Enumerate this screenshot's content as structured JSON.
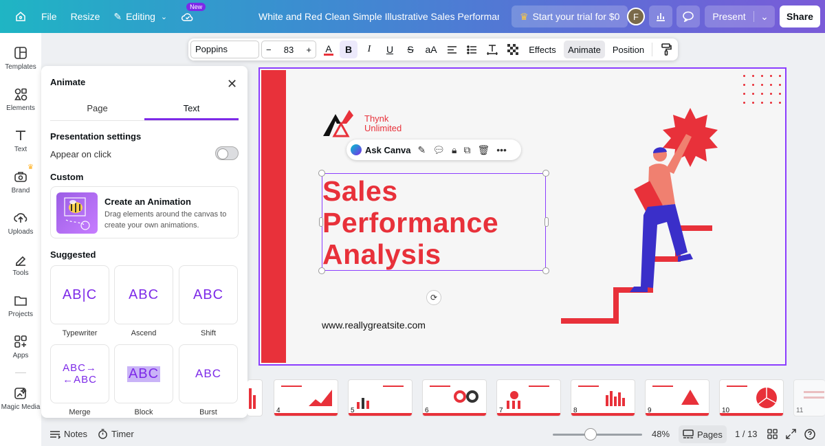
{
  "topbar": {
    "file": "File",
    "resize": "Resize",
    "editing": "Editing",
    "new_badge": "New",
    "doc_title": "White and Red Clean Simple Illustrative Sales Performance ...",
    "trial": "Start your trial for $0",
    "avatar_initial": "F",
    "present": "Present",
    "share": "Share"
  },
  "rail": [
    {
      "label": "Templates",
      "icon": "templates-icon"
    },
    {
      "label": "Elements",
      "icon": "elements-icon"
    },
    {
      "label": "Text",
      "icon": "text-icon"
    },
    {
      "label": "Brand",
      "icon": "brand-icon"
    },
    {
      "label": "Uploads",
      "icon": "uploads-icon"
    },
    {
      "label": "Tools",
      "icon": "tools-icon"
    },
    {
      "label": "Projects",
      "icon": "projects-icon"
    },
    {
      "label": "Apps",
      "icon": "apps-icon"
    },
    {
      "label": "Magic Media",
      "icon": "magic-media-icon"
    }
  ],
  "panel": {
    "title": "Animate",
    "tabs": [
      "Page",
      "Text"
    ],
    "active_tab": "Text",
    "presentation_settings": "Presentation settings",
    "appear_on_click": "Appear on click",
    "custom": "Custom",
    "create_title": "Create an Animation",
    "create_desc": "Drag elements around the canvas to create your own animations.",
    "suggested": "Suggested",
    "animations": [
      {
        "label": "Typewriter",
        "preview": "AB|C"
      },
      {
        "label": "Ascend",
        "preview": "ABC"
      },
      {
        "label": "Shift",
        "preview": "ABC"
      },
      {
        "label": "Merge",
        "preview": "ABC→ ←ABC"
      },
      {
        "label": "Block",
        "preview": "ABC"
      },
      {
        "label": "Burst",
        "preview": "ABC"
      }
    ]
  },
  "toolbar": {
    "font": "Poppins",
    "size_minus": "−",
    "size": "83",
    "size_plus": "+",
    "text_color_glyph": "A",
    "bold": "B",
    "italic": "I",
    "underline": "U",
    "strike": "S",
    "case": "aA",
    "effects": "Effects",
    "animate": "Animate",
    "position": "Position"
  },
  "slide": {
    "logo_line1": "Thynk",
    "logo_line2": "Unlimited",
    "headline_1": "Sales",
    "headline_2": "Performance",
    "headline_3": "Analysis",
    "website": "www.reallygreatsite.com",
    "accent": "#e8313a"
  },
  "ask": {
    "label": "Ask Canva"
  },
  "filmstrip": [
    "4",
    "5",
    "6",
    "7",
    "8",
    "9",
    "10",
    "11"
  ],
  "bottom": {
    "notes": "Notes",
    "timer": "Timer",
    "zoom": "48%",
    "pages": "Pages",
    "page_count": "1 / 13"
  }
}
